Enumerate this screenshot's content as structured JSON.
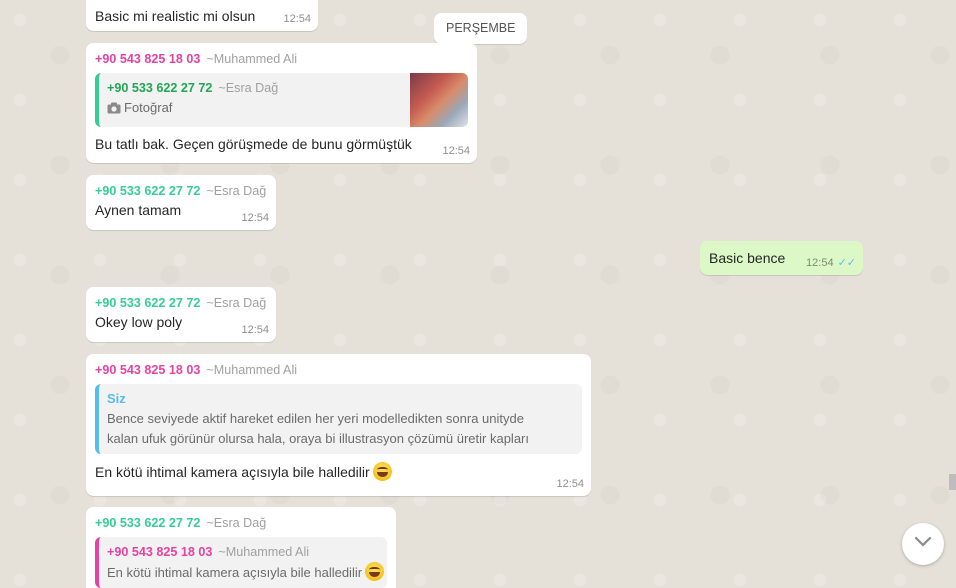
{
  "day_separator": "PERŞEMBE",
  "messages": [
    {
      "text": "Basic mi realistic mi olsun",
      "time": "12:54"
    },
    {
      "sender_number": "+90 543 825 18 03",
      "sender_alias": "~Muhammed Ali",
      "quote": {
        "number": "+90 533 622 27 72",
        "alias": "~Esra Dağ",
        "text": "Fotoğraf",
        "icon": "camera-icon"
      },
      "text": "Bu tatlı bak. Geçen görüşmede de bunu görmüştük",
      "time": "12:54"
    },
    {
      "sender_number": "+90 533 622 27 72",
      "sender_alias": "~Esra Dağ",
      "text": "Aynen tamam",
      "time": "12:54"
    },
    {
      "text": "Basic bence",
      "time": "12:54",
      "status": "read"
    },
    {
      "sender_number": "+90 533 622 27 72",
      "sender_alias": "~Esra Dağ",
      "text": "Okey low poly",
      "time": "12:54"
    },
    {
      "sender_number": "+90 543 825 18 03",
      "sender_alias": "~Muhammed Ali",
      "quote": {
        "author": "Siz",
        "text": "Bence seviyede aktif hareket edilen her yeri modelledikten sonra unityde kalan ufuk görünür olursa hala, oraya bi  illustrasyon çözümü üretir kapları"
      },
      "text": "En kötü ihtimal kamera açısıyla bile halledilir",
      "time": "12:54"
    },
    {
      "sender_number": "+90 533 622 27 72",
      "sender_alias": "~Esra Dağ",
      "quote": {
        "number": "+90 543 825 18 03",
        "alias": "~Muhammed Ali",
        "text": "En kötü ihtimal kamera açısıyla bile halledilir"
      }
    }
  ],
  "colors": {
    "outgoing_bubble": "#dcf8c6",
    "incoming_bubble": "#ffffff",
    "read_ticks": "#4fc3f7"
  }
}
